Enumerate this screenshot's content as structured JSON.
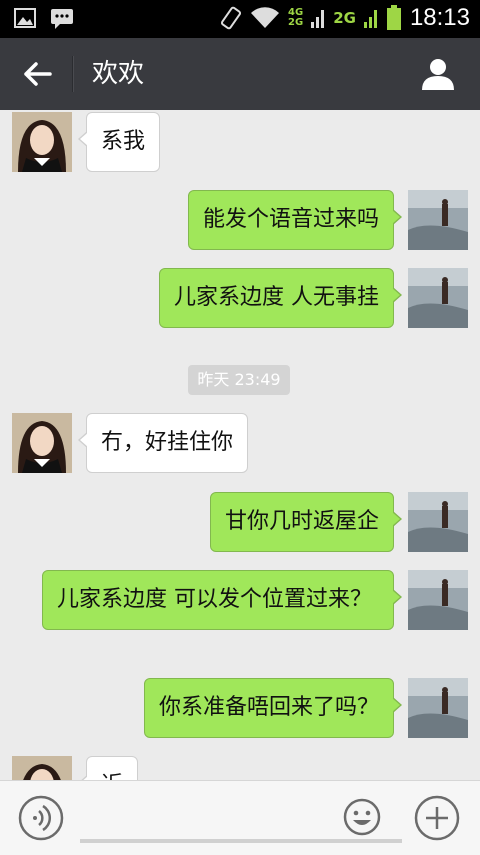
{
  "status_bar": {
    "time": "18:13",
    "network_top": "4G",
    "network_bottom": "2G",
    "network_2g": "2G"
  },
  "header": {
    "title": "欢欢"
  },
  "messages": [
    {
      "side": "in",
      "text": "系我"
    },
    {
      "side": "out",
      "text": "能发个语音过来吗"
    },
    {
      "side": "out",
      "text": "儿家系边度 人无事挂"
    },
    {
      "side": "out",
      "text": "冇，好挂住你"
    },
    {
      "side": "out",
      "text": "甘你几时返屋企"
    },
    {
      "side": "out",
      "text": "儿家系边度 可以发个位置过来？"
    },
    {
      "side": "out",
      "text": "你系准备唔回来了吗？"
    },
    {
      "side": "in",
      "text": "近"
    }
  ],
  "timestamp": "昨天 23:49",
  "colors": {
    "header_bg": "#393a3f",
    "outgoing_bubble": "#a0e75a",
    "chat_bg": "#ebebeb"
  },
  "icons": [
    "picture-icon",
    "chat-icon",
    "rotate-icon",
    "wifi-icon",
    "signal-icon",
    "battery-icon",
    "back-arrow-icon",
    "profile-icon",
    "voice-icon",
    "emoji-icon",
    "plus-icon"
  ]
}
